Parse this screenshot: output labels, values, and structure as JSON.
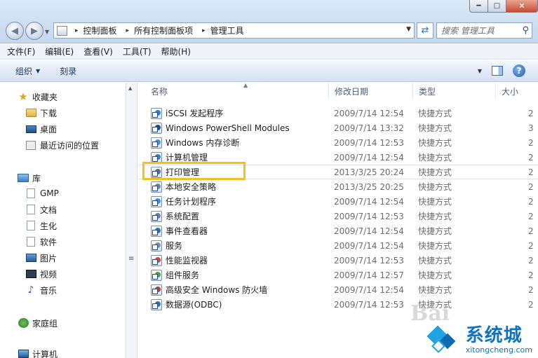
{
  "address": {
    "crumbs": [
      "控制面板",
      "所有控制面板项",
      "管理工具"
    ]
  },
  "search": {
    "placeholder": "搜索 管理工具"
  },
  "menubar": {
    "items": [
      "文件(F)",
      "编辑(E)",
      "查看(V)",
      "工具(T)",
      "帮助(H)"
    ]
  },
  "commandbar": {
    "organize": "组织",
    "burn": "刻录"
  },
  "nav": {
    "favorites": "收藏夹",
    "fav_items": [
      "下载",
      "桌面",
      "最近访问的位置"
    ],
    "libraries": "库",
    "lib_items": [
      "GMP",
      "文档",
      "生化",
      "软件",
      "图片",
      "视频",
      "音乐"
    ],
    "homegroup": "家庭组",
    "computer": "计算机"
  },
  "columns": {
    "name": "名称",
    "date": "修改日期",
    "type": "类型",
    "size": "大小"
  },
  "files": [
    {
      "name": "iSCSI 发起程序",
      "date": "2009/7/14 12:54",
      "type": "快捷方式",
      "size": "2"
    },
    {
      "name": "Windows PowerShell Modules",
      "date": "2009/7/14 13:32",
      "type": "快捷方式",
      "size": "3"
    },
    {
      "name": "Windows 内存诊断",
      "date": "2009/7/14 12:53",
      "type": "快捷方式",
      "size": "2"
    },
    {
      "name": "计算机管理",
      "date": "2009/7/14 12:54",
      "type": "快捷方式",
      "size": "2"
    },
    {
      "name": "打印管理",
      "date": "2013/3/25 20:24",
      "type": "快捷方式",
      "size": "2"
    },
    {
      "name": "本地安全策略",
      "date": "2013/3/25 20:25",
      "type": "快捷方式",
      "size": "2"
    },
    {
      "name": "任务计划程序",
      "date": "2009/7/14 12:54",
      "type": "快捷方式",
      "size": "2"
    },
    {
      "name": "系统配置",
      "date": "2009/7/14 12:53",
      "type": "快捷方式",
      "size": "2"
    },
    {
      "name": "事件查看器",
      "date": "2009/7/14 12:54",
      "type": "快捷方式",
      "size": "2"
    },
    {
      "name": "服务",
      "date": "2009/7/14 12:54",
      "type": "快捷方式",
      "size": "2"
    },
    {
      "name": "性能监视器",
      "date": "2009/7/14 12:53",
      "type": "快捷方式",
      "size": "2"
    },
    {
      "name": "组件服务",
      "date": "2009/7/14 12:57",
      "type": "快捷方式",
      "size": "2"
    },
    {
      "name": "高级安全 Windows 防火墙",
      "date": "2009/7/14 12:54",
      "type": "快捷方式",
      "size": "2"
    },
    {
      "name": "数据源(ODBC)",
      "date": "2009/7/14 12:53",
      "type": "快捷方式",
      "size": "2"
    }
  ],
  "watermark": {
    "brand_cn": "系统城",
    "brand_en": "xitongcheng.com",
    "baidu": "Bai"
  },
  "colors": {
    "highlight": "#f2c022",
    "chrome": "#c5d8ee"
  }
}
